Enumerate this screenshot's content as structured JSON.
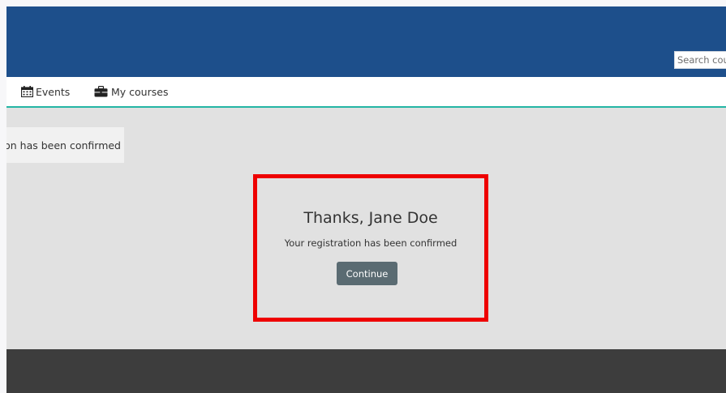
{
  "header": {
    "search_placeholder": "Search cou"
  },
  "nav": {
    "events_label": "Events",
    "courses_label": "My courses"
  },
  "notice": {
    "text": "ion has been confirmed"
  },
  "confirmation": {
    "title": "Thanks, Jane Doe",
    "message": "Your registration has been confirmed",
    "continue_label": "Continue"
  },
  "colors": {
    "header": "#1d4f8b",
    "nav_accent": "#23b5a4",
    "highlight": "#ee0000",
    "button": "#5a6b72",
    "footer": "#3d3d3d"
  },
  "icons": [
    "calendar-icon",
    "briefcase-icon"
  ]
}
